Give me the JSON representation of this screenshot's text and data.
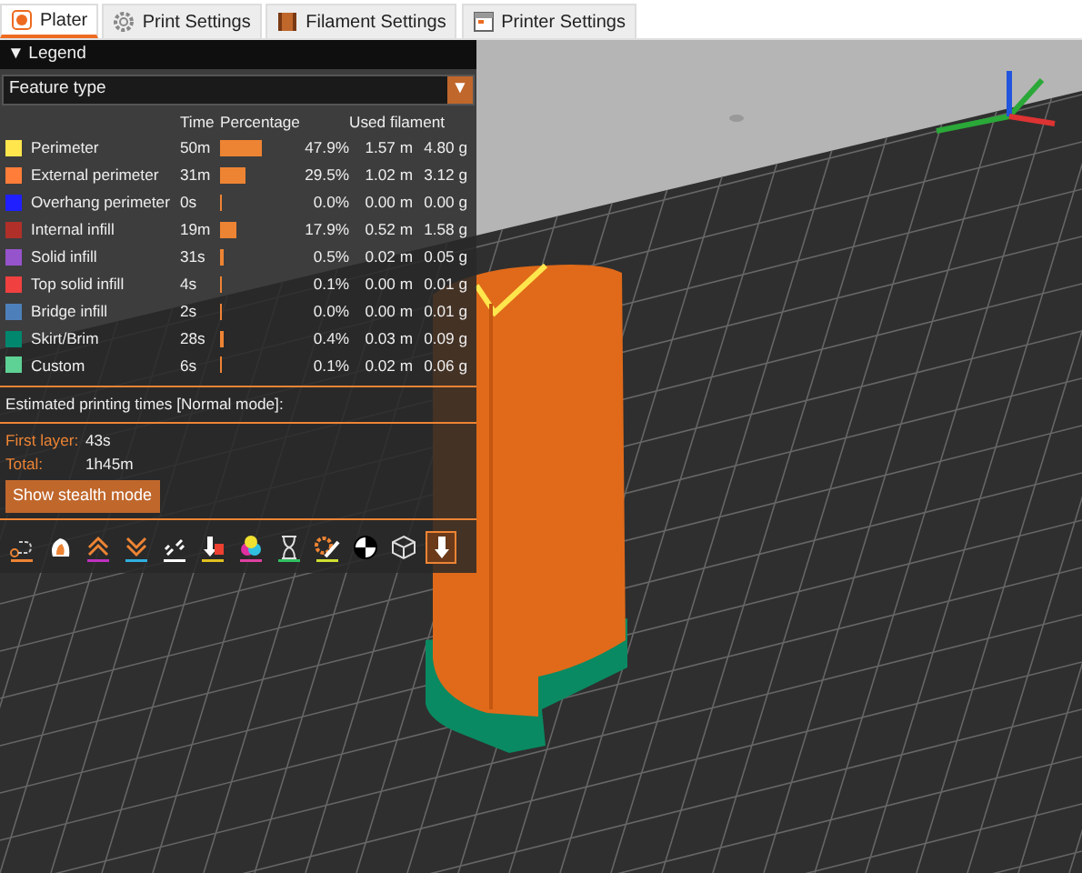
{
  "tabs": [
    {
      "label": "Plater",
      "selected": true
    },
    {
      "label": "Print Settings",
      "selected": false
    },
    {
      "label": "Filament Settings",
      "selected": false
    },
    {
      "label": "Printer Settings",
      "selected": false
    }
  ],
  "legend": {
    "toggle": "▼",
    "title": "Legend",
    "view_type": "Feature type",
    "dropdown_arrow": "▼",
    "columns": [
      "Time",
      "Percentage",
      "Used filament"
    ],
    "features": [
      {
        "name": "Perimeter",
        "time": "50m",
        "level": 0.479,
        "percentage": "47.9%",
        "length": "1.57 m",
        "weight": "4.80 g",
        "color": "#ffe64d"
      },
      {
        "name": "External perimeter",
        "time": "31m",
        "level": 0.295,
        "percentage": "29.5%",
        "length": "1.02 m",
        "weight": "3.12 g",
        "color": "#ff7d38"
      },
      {
        "name": "Overhang perimeter",
        "time": "0s",
        "level": 0.0,
        "percentage": "0.0%",
        "length": "0.00 m",
        "weight": "0.00 g",
        "color": "#1f1fff"
      },
      {
        "name": "Internal infill",
        "time": "19m",
        "level": 0.179,
        "percentage": "17.9%",
        "length": "0.52 m",
        "weight": "1.58 g",
        "color": "#b03029"
      },
      {
        "name": "Solid infill",
        "time": "31s",
        "level": 0.005,
        "percentage": "0.5%",
        "length": "0.02 m",
        "weight": "0.05 g",
        "color": "#9654cc"
      },
      {
        "name": "Top solid infill",
        "time": "4s",
        "level": 0.001,
        "percentage": "0.1%",
        "length": "0.00 m",
        "weight": "0.01 g",
        "color": "#f04040"
      },
      {
        "name": "Bridge infill",
        "time": "2s",
        "level": 0.0,
        "percentage": "0.0%",
        "length": "0.00 m",
        "weight": "0.01 g",
        "color": "#4d80ba"
      },
      {
        "name": "Skirt/Brim",
        "time": "28s",
        "level": 0.004,
        "percentage": "0.4%",
        "length": "0.03 m",
        "weight": "0.09 g",
        "color": "#00876e"
      },
      {
        "name": "Custom",
        "time": "6s",
        "level": 0.001,
        "percentage": "0.1%",
        "length": "0.02 m",
        "weight": "0.06 g",
        "color": "#5ed194"
      }
    ],
    "estimate_title": "Estimated printing times [Normal mode]:",
    "times": [
      {
        "label": "First layer:",
        "value": "43s"
      },
      {
        "label": "Total:",
        "value": "1h45m"
      }
    ],
    "stealth_button": "Show stealth mode"
  },
  "toolbar": [
    {
      "selected": false
    },
    {
      "selected": false
    },
    {
      "selected": false
    },
    {
      "selected": false
    },
    {
      "selected": false
    },
    {
      "selected": false
    },
    {
      "selected": false
    },
    {
      "selected": false
    },
    {
      "selected": false
    },
    {
      "selected": false
    },
    {
      "selected": false
    },
    {
      "selected": true
    }
  ]
}
